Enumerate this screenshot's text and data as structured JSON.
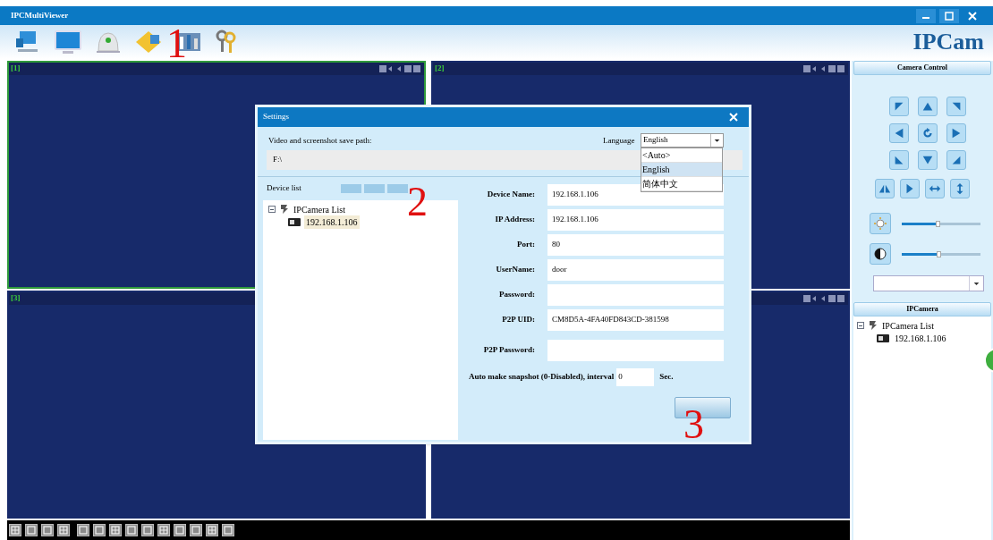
{
  "window": {
    "title": "IPCMultiViewer"
  },
  "brand": "IPCam",
  "video_cells": [
    {
      "label": "[1]",
      "selected": true
    },
    {
      "label": "[2]",
      "selected": false
    },
    {
      "label": "[3]",
      "selected": false
    },
    {
      "selected": false
    }
  ],
  "settings_dialog": {
    "title": "Settings",
    "save_path_label": "Video and screenshot save path:",
    "save_path": "F:\\",
    "language_label": "Language",
    "language_value": "English",
    "language_options": [
      {
        "label": "<Auto>",
        "selected": false
      },
      {
        "label": "English",
        "selected": true
      },
      {
        "label": "简体中文",
        "selected": false
      }
    ],
    "device_list_label": "Device list",
    "device_tree": {
      "label": "IPCamera List",
      "expanded": true,
      "children": [
        {
          "label": "192.168.1.106",
          "selected": true
        }
      ]
    },
    "fields": [
      {
        "label": "Device Name:",
        "value": "192.168.1.106"
      },
      {
        "label": "IP Address:",
        "value": "192.168.1.106"
      },
      {
        "label": "Port:",
        "value": "80"
      },
      {
        "label": "UserName:",
        "value": "door"
      },
      {
        "label": "Password:"
      },
      {
        "label": "P2P UID:",
        "value": "CM8D5A-4FA40FD843CD-381598"
      },
      {
        "label": "P2P Password:"
      }
    ],
    "snapshot": {
      "label": "Auto make snapshot (0-Disabled), interval",
      "value": "0",
      "unit": "Sec."
    }
  },
  "camera_control": {
    "title": "Camera Control",
    "sliders": [
      {
        "kind": "brightness",
        "level": 0.45
      },
      {
        "kind": "contrast",
        "level": 0.47
      }
    ]
  },
  "ipcamera": {
    "title": "IPCamera",
    "tree": {
      "label": "IPCamera List",
      "expanded": true,
      "children": [
        {
          "label": "192.168.1.106",
          "selected": false
        }
      ]
    }
  },
  "annotations": [
    "1",
    "2",
    "3"
  ]
}
